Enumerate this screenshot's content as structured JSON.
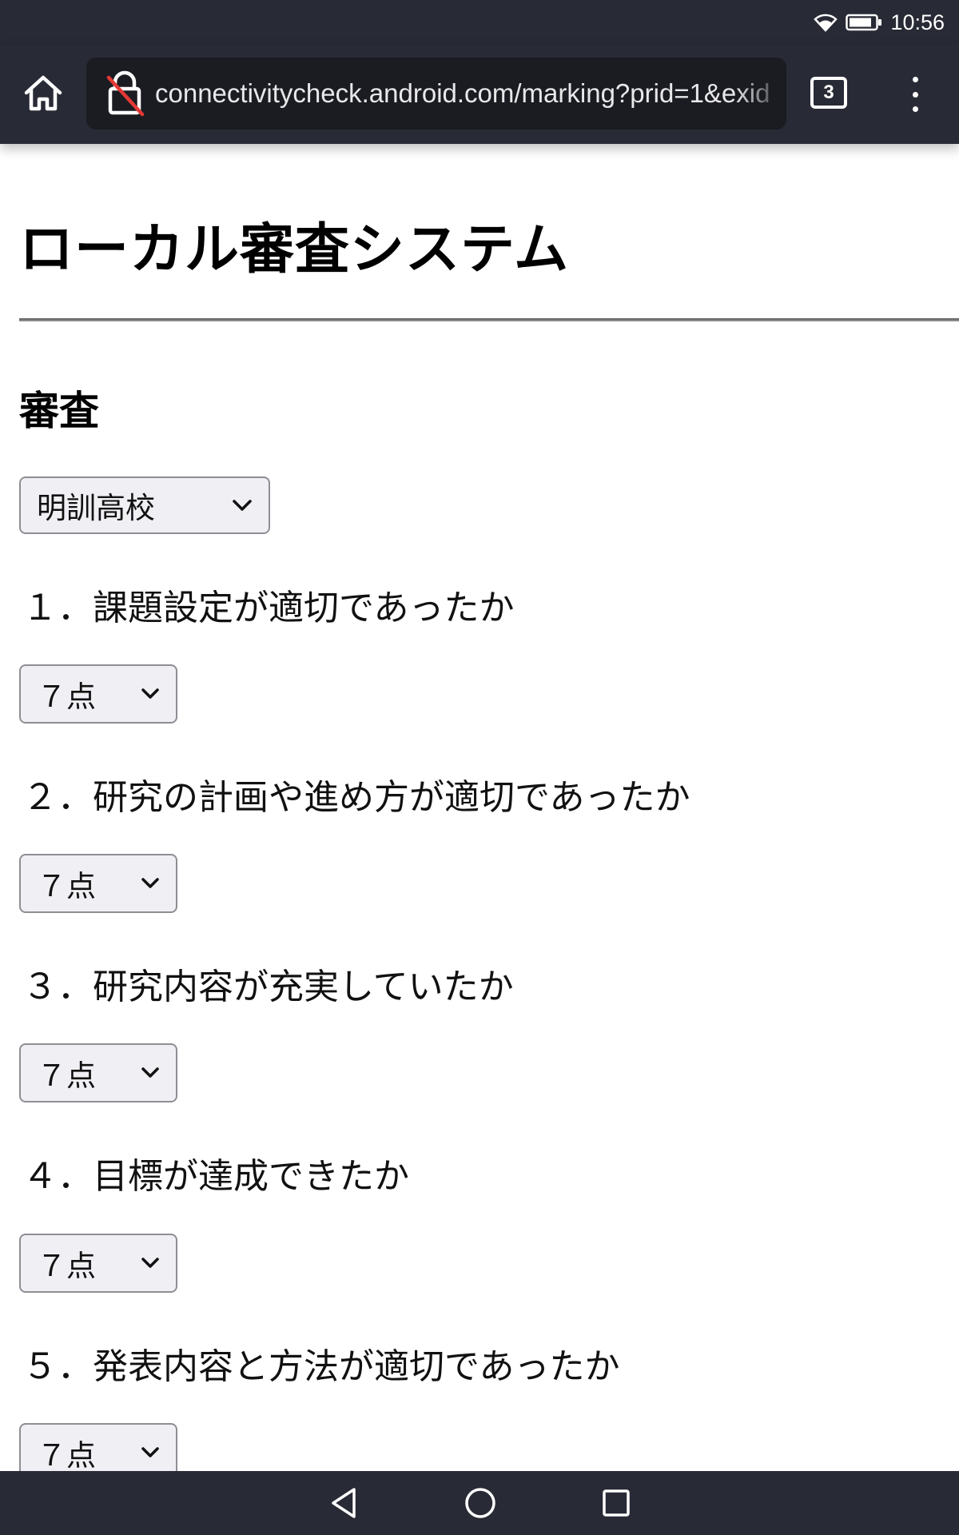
{
  "status_bar": {
    "time": "10:56",
    "wifi_icon": "wifi-icon",
    "battery_icon": "battery-icon"
  },
  "browser": {
    "url": "connectivitycheck.android.com/marking?prid=1&exid",
    "tab_count": "3",
    "home_icon": "home-icon",
    "lock_icon": "lock-insecure-icon",
    "menu_icon": "more-vert-icon"
  },
  "page": {
    "title": "ローカル審査システム",
    "section_title": "審査",
    "school_select": {
      "value": "明訓高校"
    },
    "questions": [
      {
        "label": "１．課題設定が適切であったか",
        "score": "７点"
      },
      {
        "label": "２．研究の計画や進め方が適切であったか",
        "score": "７点"
      },
      {
        "label": "３．研究内容が充実していたか",
        "score": "７点"
      },
      {
        "label": "４．目標が達成できたか",
        "score": "７点"
      },
      {
        "label": "５．発表内容と方法が適切であったか",
        "score": "７点"
      }
    ]
  },
  "nav_bar": {
    "back_icon": "back-triangle-icon",
    "home_icon": "home-circle-icon",
    "recents_icon": "recents-square-icon"
  },
  "colors": {
    "chrome_bg": "#282a35",
    "url_bg": "#1b1c22",
    "select_bg": "#efeff4"
  }
}
